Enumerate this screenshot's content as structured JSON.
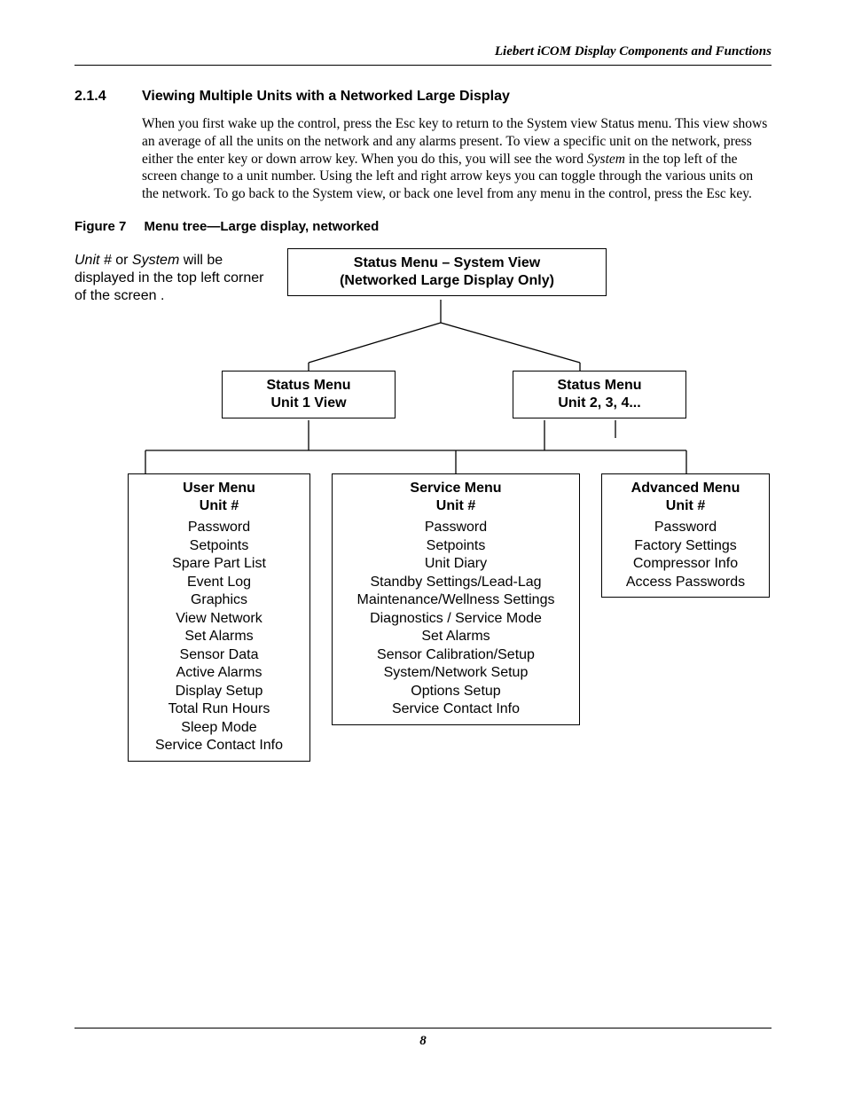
{
  "running_head": "Liebert iCOM Display Components and Functions",
  "section": {
    "number": "2.1.4",
    "title": "Viewing Multiple Units with a Networked Large Display"
  },
  "body_html": "When you first wake up the control, press the Esc key to return to the System view Status menu. This view shows an average of all the units on the network and any alarms present. To view a specific unit on the network, press either the enter key or down arrow key. When you do this, you will see the word <i>System</i> in the top left of the screen change to a unit number. Using the left and right arrow keys you can toggle through the various units on the network. To go back to the System view, or back one level from any menu in the control, press the Esc key.",
  "figure": {
    "label": "Figure 7",
    "title": "Menu tree—Large display, networked"
  },
  "diagram": {
    "note_prefix_italic": "Unit # ",
    "note_mid1": "or ",
    "note_mid_italic": "System",
    "note_rest": " will be displayed in the top left corner of the screen .",
    "top": {
      "line1": "Status Menu – System View",
      "line2": "(Networked Large Display Only)"
    },
    "mid_left": {
      "line1": "Status Menu",
      "line2": "Unit 1 View"
    },
    "mid_right": {
      "line1": "Status Menu",
      "line2": "Unit 2, 3, 4..."
    },
    "user": {
      "title1": "User Menu",
      "title2": "Unit #",
      "items": [
        "Password",
        "Setpoints",
        "Spare Part List",
        "Event Log",
        "Graphics",
        "View Network",
        "Set Alarms",
        "Sensor Data",
        "Active Alarms",
        "Display Setup",
        "Total Run Hours",
        "Sleep Mode",
        "Service Contact Info"
      ]
    },
    "service": {
      "title1": "Service Menu",
      "title2": "Unit #",
      "items": [
        "Password",
        "Setpoints",
        "Unit Diary",
        "Standby Settings/Lead-Lag",
        "Maintenance/Wellness Settings",
        "Diagnostics / Service Mode",
        "Set Alarms",
        "Sensor Calibration/Setup",
        "System/Network Setup",
        "Options Setup",
        "Service Contact Info"
      ]
    },
    "advanced": {
      "title1": "Advanced Menu",
      "title2": "Unit #",
      "items": [
        "Password",
        "Factory Settings",
        "Compressor Info",
        "Access Passwords"
      ]
    }
  },
  "page_number": "8"
}
